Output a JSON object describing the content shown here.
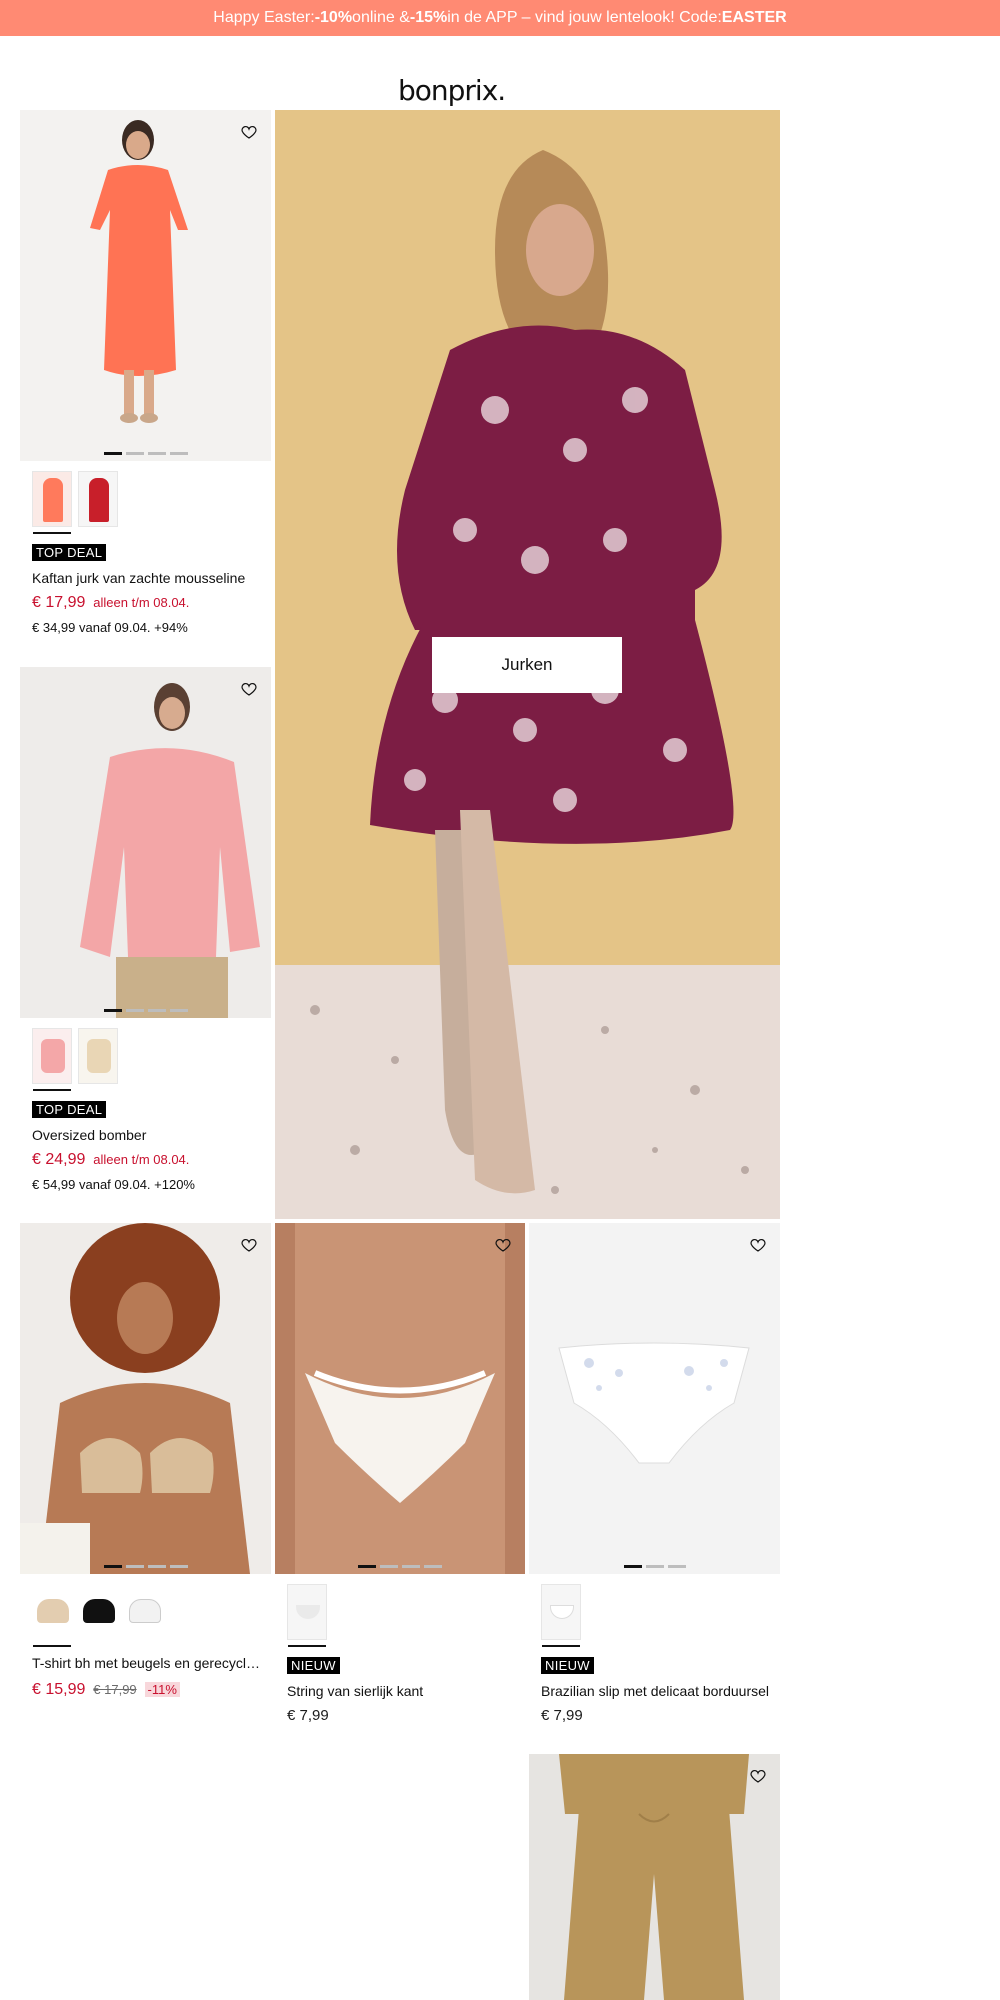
{
  "promo": {
    "prefix": "Happy Easter: ",
    "discount_online": "-10%",
    "mid1": " online & ",
    "discount_app": "-15%",
    "mid2": " in de APP – vind jouw lentelook! Code: ",
    "code": "EASTER"
  },
  "logo": {
    "text": "bonprix."
  },
  "hero": {
    "cta_label": "Jurken"
  },
  "products": [
    {
      "badge": "TOP DEAL",
      "title": "Kaftan jurk van zachte mousseline",
      "price": "€ 17,99",
      "price_note": "alleen t/m 08.04.",
      "sub": "€ 34,99 vanaf 09.04. +94%",
      "colors": [
        "#ff7a5c",
        "#c81f2a"
      ]
    },
    {
      "badge": "TOP DEAL",
      "title": "Oversized bomber",
      "price": "€ 24,99",
      "price_note": "alleen t/m 08.04.",
      "sub": "€ 54,99 vanaf 09.04. +120%",
      "colors": [
        "#f4a7a8",
        "#e9d6b5"
      ]
    },
    {
      "title": "T-shirt bh met beugels en gerecycled...",
      "price": "€ 15,99",
      "old_price": "€ 17,99",
      "discount": "-11%",
      "colors": [
        "#e3cdb0",
        "#111111",
        "#ffffff"
      ]
    },
    {
      "badge": "NIEUW",
      "title": "String van sierlijk kant",
      "price": "€ 7,99",
      "colors": [
        "#f6f6f6"
      ]
    },
    {
      "badge": "NIEUW",
      "title": "Brazilian slip met delicaat borduursel",
      "price": "€ 7,99",
      "colors": [
        "#f6f6f6"
      ]
    }
  ],
  "icons": {
    "heart": "heart-icon",
    "logo": "bonprix-logo"
  }
}
